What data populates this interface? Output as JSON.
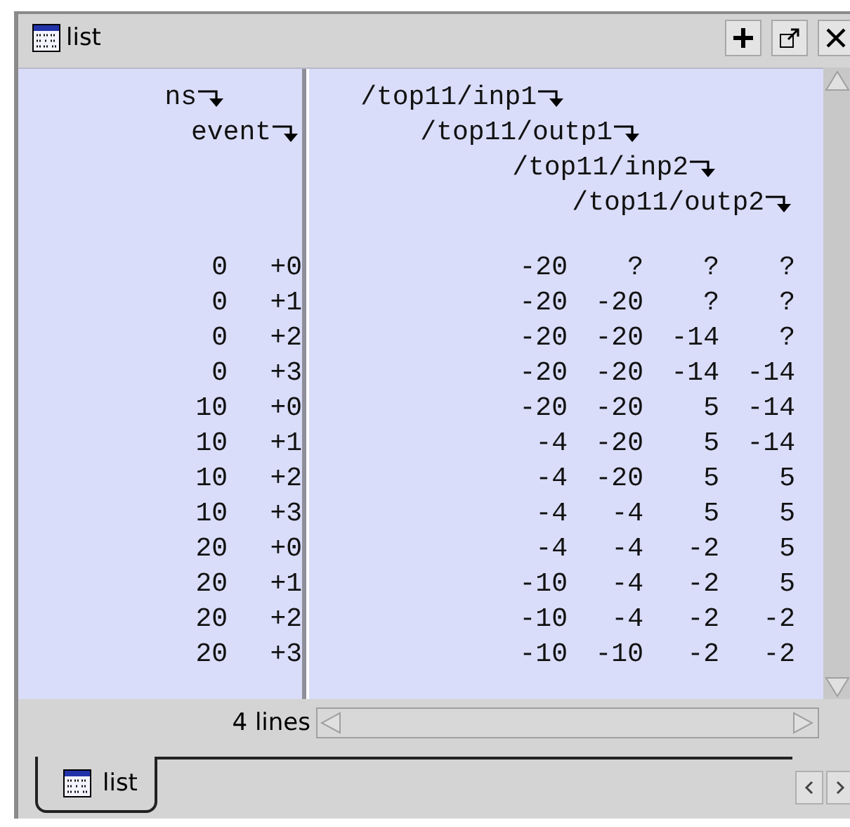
{
  "window": {
    "title": "list"
  },
  "left_headers": [
    "ns",
    "event"
  ],
  "signals": [
    "/top11/inp1",
    "/top11/outp1",
    "/top11/inp2",
    "/top11/outp2"
  ],
  "rows": [
    {
      "ns": "0",
      "event": "+0",
      "values": [
        "-20",
        "?",
        "?",
        "?"
      ]
    },
    {
      "ns": "0",
      "event": "+1",
      "values": [
        "-20",
        "-20",
        "?",
        "?"
      ]
    },
    {
      "ns": "0",
      "event": "+2",
      "values": [
        "-20",
        "-20",
        "-14",
        "?"
      ]
    },
    {
      "ns": "0",
      "event": "+3",
      "values": [
        "-20",
        "-20",
        "-14",
        "-14"
      ]
    },
    {
      "ns": "10",
      "event": "+0",
      "values": [
        "-20",
        "-20",
        "5",
        "-14"
      ]
    },
    {
      "ns": "10",
      "event": "+1",
      "values": [
        "-4",
        "-20",
        "5",
        "-14"
      ]
    },
    {
      "ns": "10",
      "event": "+2",
      "values": [
        "-4",
        "-20",
        "5",
        "5"
      ]
    },
    {
      "ns": "10",
      "event": "+3",
      "values": [
        "-4",
        "-4",
        "5",
        "5"
      ]
    },
    {
      "ns": "20",
      "event": "+0",
      "values": [
        "-4",
        "-4",
        "-2",
        "5"
      ]
    },
    {
      "ns": "20",
      "event": "+1",
      "values": [
        "-10",
        "-4",
        "-2",
        "5"
      ]
    },
    {
      "ns": "20",
      "event": "+2",
      "values": [
        "-10",
        "-4",
        "-2",
        "-2"
      ]
    },
    {
      "ns": "20",
      "event": "+3",
      "values": [
        "-10",
        "-10",
        "-2",
        "-2"
      ]
    }
  ],
  "status": "4 lines",
  "tabs": [
    {
      "label": "list",
      "selected": true
    }
  ]
}
